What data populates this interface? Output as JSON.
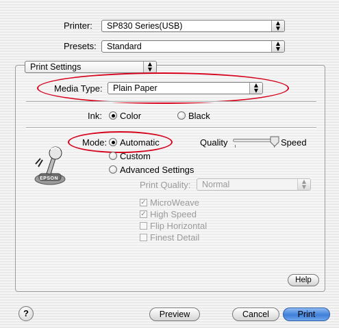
{
  "printer": {
    "label": "Printer:",
    "value": "SP830 Series(USB)"
  },
  "presets": {
    "label": "Presets:",
    "value": "Standard"
  },
  "pane_select": {
    "value": "Print Settings"
  },
  "media_type": {
    "label": "Media Type:",
    "value": "Plain Paper"
  },
  "ink": {
    "label": "Ink:",
    "options": [
      "Color",
      "Black"
    ],
    "selected": "Color"
  },
  "mode": {
    "label": "Mode:",
    "options": [
      "Automatic",
      "Custom",
      "Advanced Settings"
    ],
    "selected": "Automatic"
  },
  "slider": {
    "left_label": "Quality",
    "right_label": "Speed",
    "position": 1.0
  },
  "print_quality": {
    "label": "Print Quality:",
    "value": "Normal"
  },
  "checkboxes": [
    {
      "label": "MicroWeave",
      "checked": true
    },
    {
      "label": "High Speed",
      "checked": true
    },
    {
      "label": "Flip Horizontal",
      "checked": false
    },
    {
      "label": "Finest Detail",
      "checked": false
    }
  ],
  "logo": {
    "text": "EPSON"
  },
  "buttons": {
    "help": "Help",
    "help_icon": "?",
    "preview": "Preview",
    "cancel": "Cancel",
    "print": "Print"
  },
  "colors": {
    "highlight_ellipse": "#d6001c",
    "default_button": "#3f7fd8"
  }
}
